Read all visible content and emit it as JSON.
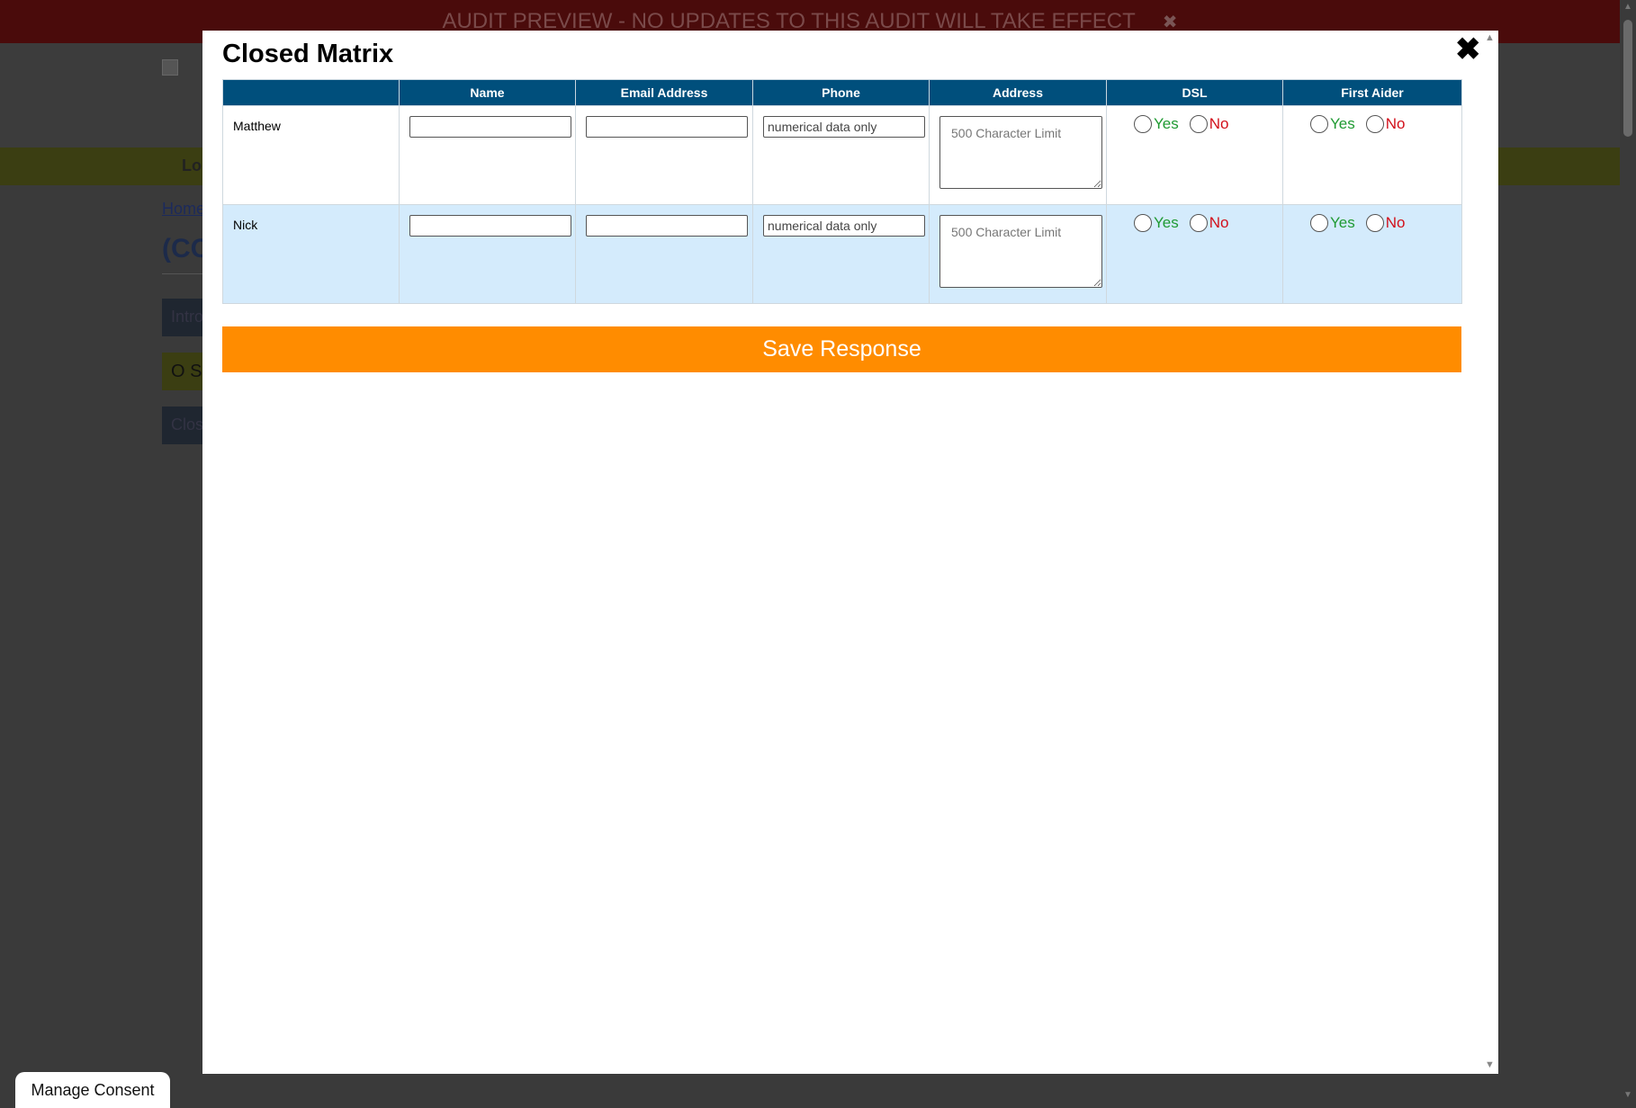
{
  "background": {
    "banner_text": "AUDIT PREVIEW - NO UPDATES TO THIS AUDIT WILL TAKE EFFECT",
    "nav_fragment": "Lo",
    "home_link": "Home",
    "title_fragment": "(CO",
    "box1_fragment": "Intro",
    "box2_fragment": "O S",
    "box3_fragment": "Clos"
  },
  "consent_label": "Manage Consent",
  "modal": {
    "title": "Closed Matrix",
    "columns": [
      "",
      "Name",
      "Email Address",
      "Phone",
      "Address",
      "DSL",
      "First Aider"
    ],
    "rows": [
      {
        "name": "Matthew"
      },
      {
        "name": "Nick"
      }
    ],
    "phone_placeholder": "numerical data only",
    "address_placeholder": "500 Character Limit",
    "yes_label": "Yes",
    "no_label": "No",
    "save_label": "Save Response"
  },
  "colors": {
    "header_bg": "#004f7c",
    "save_bg": "#ff8c00",
    "yes": "#1f9a32",
    "no": "#d2101a",
    "alt_row": "#d4ebfc"
  }
}
